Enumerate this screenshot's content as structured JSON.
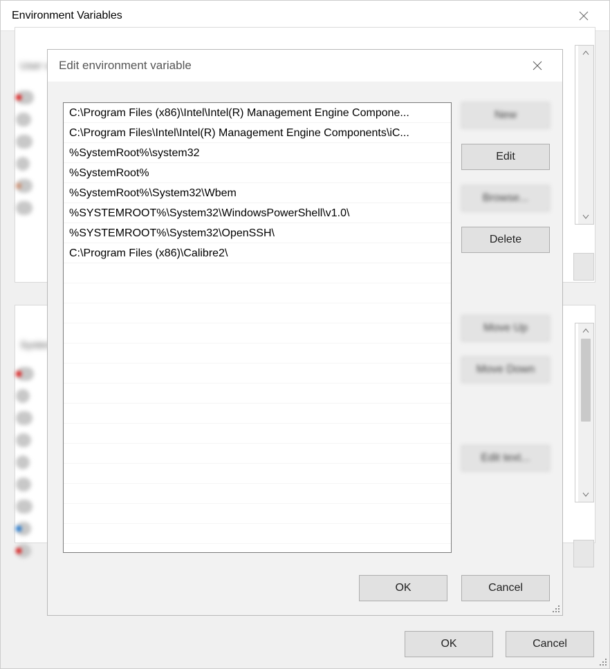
{
  "parent": {
    "title": "Environment Variables",
    "user_group_label": "User variables",
    "system_group_label": "System variables",
    "ok_label": "OK",
    "cancel_label": "Cancel"
  },
  "modal": {
    "title": "Edit environment variable",
    "path_entries": [
      "C:\\Program Files (x86)\\Intel\\Intel(R) Management Engine Compone...",
      "C:\\Program Files\\Intel\\Intel(R) Management Engine Components\\iC...",
      "%SystemRoot%\\system32",
      "%SystemRoot%",
      "%SystemRoot%\\System32\\Wbem",
      "%SYSTEMROOT%\\System32\\WindowsPowerShell\\v1.0\\",
      "%SYSTEMROOT%\\System32\\OpenSSH\\",
      "C:\\Program Files (x86)\\Calibre2\\"
    ],
    "side_buttons": {
      "new": "New",
      "edit": "Edit",
      "browse": "Browse...",
      "delete": "Delete",
      "move_up": "Move Up",
      "move_down": "Move Down",
      "edit_text": "Edit text..."
    },
    "ok_label": "OK",
    "cancel_label": "Cancel"
  },
  "colors": {
    "window_bg": "#f0f0f0",
    "button_bg": "#e1e1e1"
  }
}
